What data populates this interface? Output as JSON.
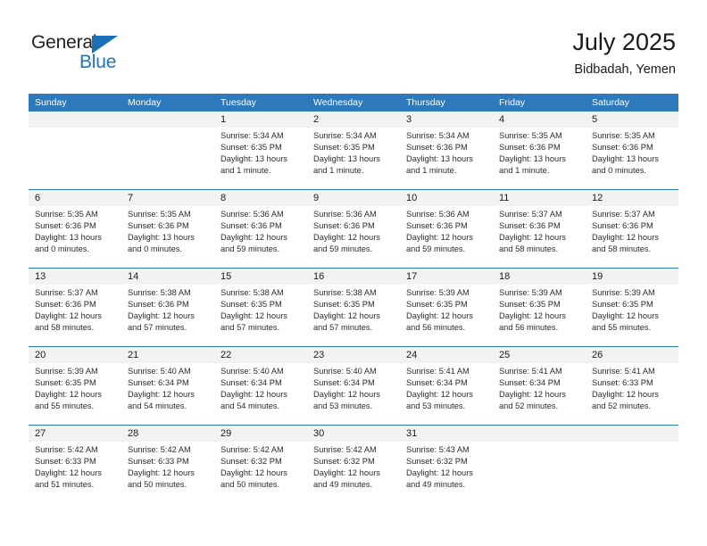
{
  "brand": {
    "name_part1": "General",
    "name_part2": "Blue",
    "accent_color": "#1a76c4",
    "triangle_color": "#1a70b8"
  },
  "header": {
    "title": "July 2025",
    "subtitle": "Bidbadah, Yemen"
  },
  "theme": {
    "header_row_bg": "#2e78bc",
    "daynum_bg": "#f2f2f2",
    "divider": "#2e78bc",
    "text": "#2b2b2b"
  },
  "calendar": {
    "weekday_headers": [
      "Sunday",
      "Monday",
      "Tuesday",
      "Wednesday",
      "Thursday",
      "Friday",
      "Saturday"
    ],
    "weeks": [
      [
        {
          "day": "",
          "sunrise": "",
          "sunset": "",
          "daylight1": "",
          "daylight2": ""
        },
        {
          "day": "",
          "sunrise": "",
          "sunset": "",
          "daylight1": "",
          "daylight2": ""
        },
        {
          "day": "1",
          "sunrise": "Sunrise: 5:34 AM",
          "sunset": "Sunset: 6:35 PM",
          "daylight1": "Daylight: 13 hours",
          "daylight2": "and 1 minute."
        },
        {
          "day": "2",
          "sunrise": "Sunrise: 5:34 AM",
          "sunset": "Sunset: 6:35 PM",
          "daylight1": "Daylight: 13 hours",
          "daylight2": "and 1 minute."
        },
        {
          "day": "3",
          "sunrise": "Sunrise: 5:34 AM",
          "sunset": "Sunset: 6:36 PM",
          "daylight1": "Daylight: 13 hours",
          "daylight2": "and 1 minute."
        },
        {
          "day": "4",
          "sunrise": "Sunrise: 5:35 AM",
          "sunset": "Sunset: 6:36 PM",
          "daylight1": "Daylight: 13 hours",
          "daylight2": "and 1 minute."
        },
        {
          "day": "5",
          "sunrise": "Sunrise: 5:35 AM",
          "sunset": "Sunset: 6:36 PM",
          "daylight1": "Daylight: 13 hours",
          "daylight2": "and 0 minutes."
        }
      ],
      [
        {
          "day": "6",
          "sunrise": "Sunrise: 5:35 AM",
          "sunset": "Sunset: 6:36 PM",
          "daylight1": "Daylight: 13 hours",
          "daylight2": "and 0 minutes."
        },
        {
          "day": "7",
          "sunrise": "Sunrise: 5:35 AM",
          "sunset": "Sunset: 6:36 PM",
          "daylight1": "Daylight: 13 hours",
          "daylight2": "and 0 minutes."
        },
        {
          "day": "8",
          "sunrise": "Sunrise: 5:36 AM",
          "sunset": "Sunset: 6:36 PM",
          "daylight1": "Daylight: 12 hours",
          "daylight2": "and 59 minutes."
        },
        {
          "day": "9",
          "sunrise": "Sunrise: 5:36 AM",
          "sunset": "Sunset: 6:36 PM",
          "daylight1": "Daylight: 12 hours",
          "daylight2": "and 59 minutes."
        },
        {
          "day": "10",
          "sunrise": "Sunrise: 5:36 AM",
          "sunset": "Sunset: 6:36 PM",
          "daylight1": "Daylight: 12 hours",
          "daylight2": "and 59 minutes."
        },
        {
          "day": "11",
          "sunrise": "Sunrise: 5:37 AM",
          "sunset": "Sunset: 6:36 PM",
          "daylight1": "Daylight: 12 hours",
          "daylight2": "and 58 minutes."
        },
        {
          "day": "12",
          "sunrise": "Sunrise: 5:37 AM",
          "sunset": "Sunset: 6:36 PM",
          "daylight1": "Daylight: 12 hours",
          "daylight2": "and 58 minutes."
        }
      ],
      [
        {
          "day": "13",
          "sunrise": "Sunrise: 5:37 AM",
          "sunset": "Sunset: 6:36 PM",
          "daylight1": "Daylight: 12 hours",
          "daylight2": "and 58 minutes."
        },
        {
          "day": "14",
          "sunrise": "Sunrise: 5:38 AM",
          "sunset": "Sunset: 6:36 PM",
          "daylight1": "Daylight: 12 hours",
          "daylight2": "and 57 minutes."
        },
        {
          "day": "15",
          "sunrise": "Sunrise: 5:38 AM",
          "sunset": "Sunset: 6:35 PM",
          "daylight1": "Daylight: 12 hours",
          "daylight2": "and 57 minutes."
        },
        {
          "day": "16",
          "sunrise": "Sunrise: 5:38 AM",
          "sunset": "Sunset: 6:35 PM",
          "daylight1": "Daylight: 12 hours",
          "daylight2": "and 57 minutes."
        },
        {
          "day": "17",
          "sunrise": "Sunrise: 5:39 AM",
          "sunset": "Sunset: 6:35 PM",
          "daylight1": "Daylight: 12 hours",
          "daylight2": "and 56 minutes."
        },
        {
          "day": "18",
          "sunrise": "Sunrise: 5:39 AM",
          "sunset": "Sunset: 6:35 PM",
          "daylight1": "Daylight: 12 hours",
          "daylight2": "and 56 minutes."
        },
        {
          "day": "19",
          "sunrise": "Sunrise: 5:39 AM",
          "sunset": "Sunset: 6:35 PM",
          "daylight1": "Daylight: 12 hours",
          "daylight2": "and 55 minutes."
        }
      ],
      [
        {
          "day": "20",
          "sunrise": "Sunrise: 5:39 AM",
          "sunset": "Sunset: 6:35 PM",
          "daylight1": "Daylight: 12 hours",
          "daylight2": "and 55 minutes."
        },
        {
          "day": "21",
          "sunrise": "Sunrise: 5:40 AM",
          "sunset": "Sunset: 6:34 PM",
          "daylight1": "Daylight: 12 hours",
          "daylight2": "and 54 minutes."
        },
        {
          "day": "22",
          "sunrise": "Sunrise: 5:40 AM",
          "sunset": "Sunset: 6:34 PM",
          "daylight1": "Daylight: 12 hours",
          "daylight2": "and 54 minutes."
        },
        {
          "day": "23",
          "sunrise": "Sunrise: 5:40 AM",
          "sunset": "Sunset: 6:34 PM",
          "daylight1": "Daylight: 12 hours",
          "daylight2": "and 53 minutes."
        },
        {
          "day": "24",
          "sunrise": "Sunrise: 5:41 AM",
          "sunset": "Sunset: 6:34 PM",
          "daylight1": "Daylight: 12 hours",
          "daylight2": "and 53 minutes."
        },
        {
          "day": "25",
          "sunrise": "Sunrise: 5:41 AM",
          "sunset": "Sunset: 6:34 PM",
          "daylight1": "Daylight: 12 hours",
          "daylight2": "and 52 minutes."
        },
        {
          "day": "26",
          "sunrise": "Sunrise: 5:41 AM",
          "sunset": "Sunset: 6:33 PM",
          "daylight1": "Daylight: 12 hours",
          "daylight2": "and 52 minutes."
        }
      ],
      [
        {
          "day": "27",
          "sunrise": "Sunrise: 5:42 AM",
          "sunset": "Sunset: 6:33 PM",
          "daylight1": "Daylight: 12 hours",
          "daylight2": "and 51 minutes."
        },
        {
          "day": "28",
          "sunrise": "Sunrise: 5:42 AM",
          "sunset": "Sunset: 6:33 PM",
          "daylight1": "Daylight: 12 hours",
          "daylight2": "and 50 minutes."
        },
        {
          "day": "29",
          "sunrise": "Sunrise: 5:42 AM",
          "sunset": "Sunset: 6:32 PM",
          "daylight1": "Daylight: 12 hours",
          "daylight2": "and 50 minutes."
        },
        {
          "day": "30",
          "sunrise": "Sunrise: 5:42 AM",
          "sunset": "Sunset: 6:32 PM",
          "daylight1": "Daylight: 12 hours",
          "daylight2": "and 49 minutes."
        },
        {
          "day": "31",
          "sunrise": "Sunrise: 5:43 AM",
          "sunset": "Sunset: 6:32 PM",
          "daylight1": "Daylight: 12 hours",
          "daylight2": "and 49 minutes."
        },
        {
          "day": "",
          "sunrise": "",
          "sunset": "",
          "daylight1": "",
          "daylight2": ""
        },
        {
          "day": "",
          "sunrise": "",
          "sunset": "",
          "daylight1": "",
          "daylight2": ""
        }
      ]
    ]
  }
}
